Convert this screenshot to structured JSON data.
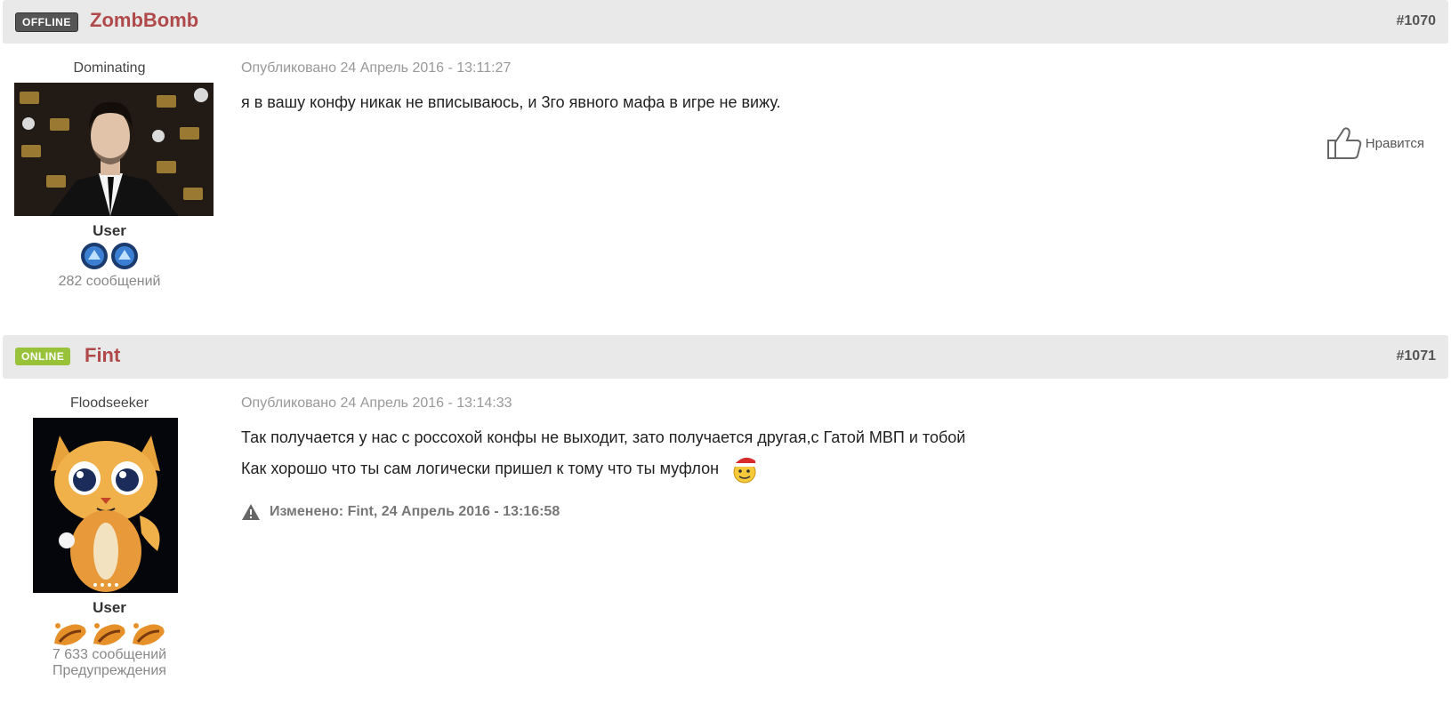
{
  "posts": [
    {
      "status": "OFFLINE",
      "author": "ZombBomb",
      "number": "#1070",
      "user_title": "Dominating",
      "group": "User",
      "post_count": "282 сообщений",
      "date": "Опубликовано 24 Апрель 2016 - 13:11:27",
      "text": "я в вашу конфу никак не вписываюсь, и 3го явного мафа в игре не вижу.",
      "like_label": "Нравится"
    },
    {
      "status": "ONLINE",
      "author": "Fint",
      "number": "#1071",
      "user_title": "Floodseeker",
      "group": "User",
      "post_count": "7 633 сообщений",
      "warnings": "Предупреждения",
      "date": "Опубликовано 24 Апрель 2016 - 13:14:33",
      "text_line1": "Так получается у нас с россохой конфы не выходит, зато получается другая,с Гатой МВП и тобой",
      "text_line2": "Как хорошо что ты сам логически пришел к тому что ты муфлон",
      "edit_note": "Изменено: Fint, 24 Апрель 2016 - 13:16:58"
    }
  ],
  "colors": {
    "author": "#b04a4a",
    "online": "#98c23a",
    "offline": "#555555",
    "header_bg": "#e9e9e9"
  }
}
